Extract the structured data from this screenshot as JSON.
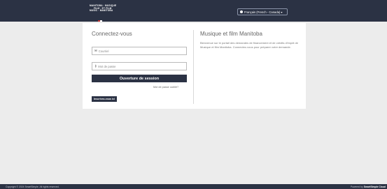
{
  "header": {
    "logo_lines": [
      "MANITOBA · MUSIQUE",
      "FILM · ET FILM",
      "MUSIC · MANITOBA"
    ],
    "language_label": "Français (French - Canada)",
    "language_icon": "globe-icon"
  },
  "login": {
    "title": "Connectez-vous",
    "email_placeholder": "Courriel",
    "email_icon": "envelope-icon",
    "password_placeholder": "Mot de passe",
    "password_icon": "key-icon",
    "submit_label": "Ouverture de session",
    "forgot_label": "Mot de passe oublié?",
    "register_label": "Inscrivez-vous ici"
  },
  "info": {
    "title": "Musique et film Manitoba",
    "body": "Bienvenue sur le portail des demandes de financement et de crédits d'impôt de Musique et film Manitoba. Connectez-vous pour préparer votre demande."
  },
  "footer": {
    "copyright": "Copyright © 2024 SmartSimple. All rights reserved.",
    "powered_prefix": "Powered by ",
    "powered_brand": "SmartSimple Cloud"
  },
  "colors": {
    "header_bg": "#2b3244",
    "button_bg": "#2b3244",
    "page_bg": "#ececec",
    "card_bg": "#ffffff"
  }
}
